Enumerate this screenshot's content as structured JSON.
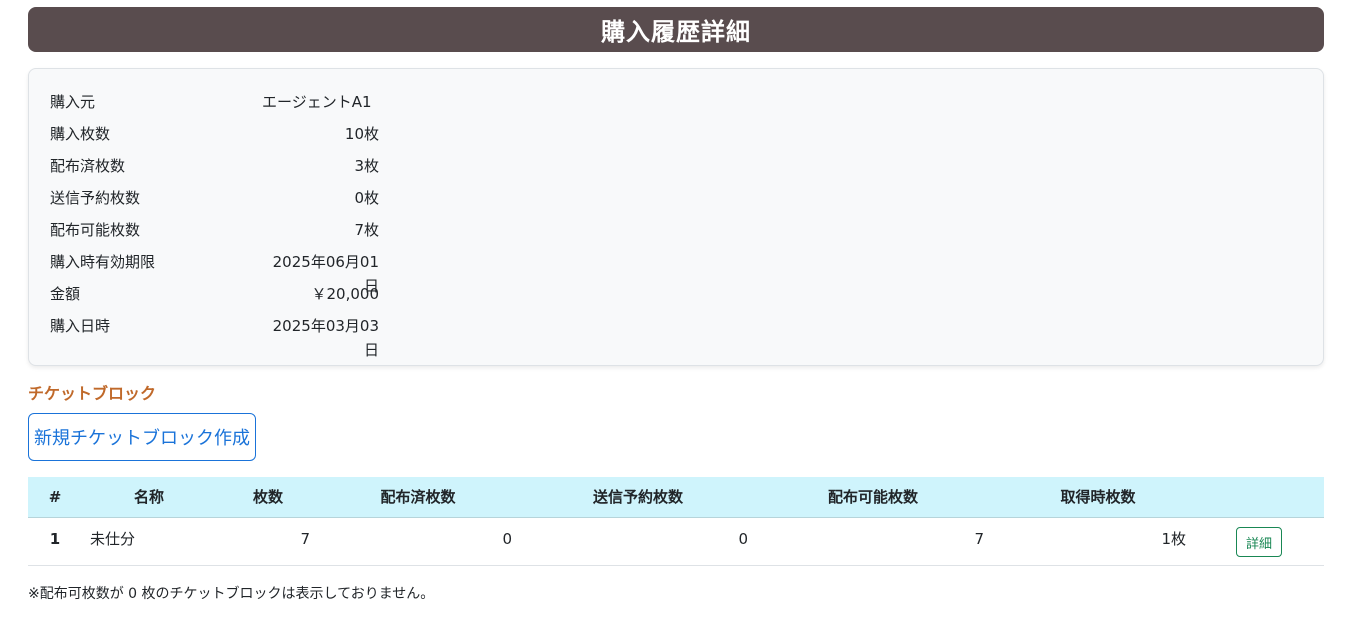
{
  "page": {
    "title": "購入履歴詳細"
  },
  "details": [
    {
      "label": "購入元",
      "value": "エージェントA1"
    },
    {
      "label": "購入枚数",
      "value": "10枚"
    },
    {
      "label": "配布済枚数",
      "value": "3枚"
    },
    {
      "label": "送信予約枚数",
      "value": "0枚"
    },
    {
      "label": "配布可能枚数",
      "value": "7枚"
    },
    {
      "label": "購入時有効期限",
      "value": "2025年06月01日"
    },
    {
      "label": "金額",
      "value": "￥20,000"
    },
    {
      "label": "購入日時",
      "value": "2025年03月03日"
    }
  ],
  "ticket_blocks": {
    "section_title": "チケットブロック",
    "create_button": "新規チケットブロック作成",
    "columns": [
      "#",
      "名称",
      "枚数",
      "配布済枚数",
      "送信予約枚数",
      "配布可能枚数",
      "取得時枚数",
      ""
    ],
    "rows": [
      {
        "index": "1",
        "name": "未仕分",
        "count": "7",
        "distributed": "0",
        "scheduled": "0",
        "available": "7",
        "acquired": "1枚",
        "action": "詳細"
      }
    ],
    "note": "※配布可枚数が 0 枚のチケットブロックは表示しておりません。"
  }
}
